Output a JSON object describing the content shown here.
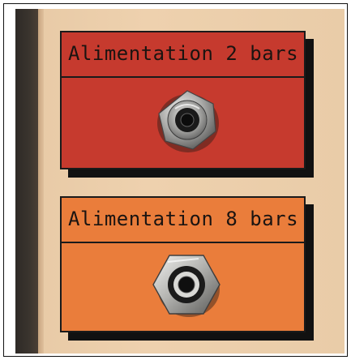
{
  "panels": [
    {
      "label": "Alimentation 2 bars",
      "color": "#c63a2e"
    },
    {
      "label": "Alimentation 8 bars",
      "color": "#ea7d3b"
    }
  ],
  "fittings": [
    {
      "icon": "round-compression-fitting-icon"
    },
    {
      "icon": "hex-nut-fitting-icon"
    }
  ]
}
